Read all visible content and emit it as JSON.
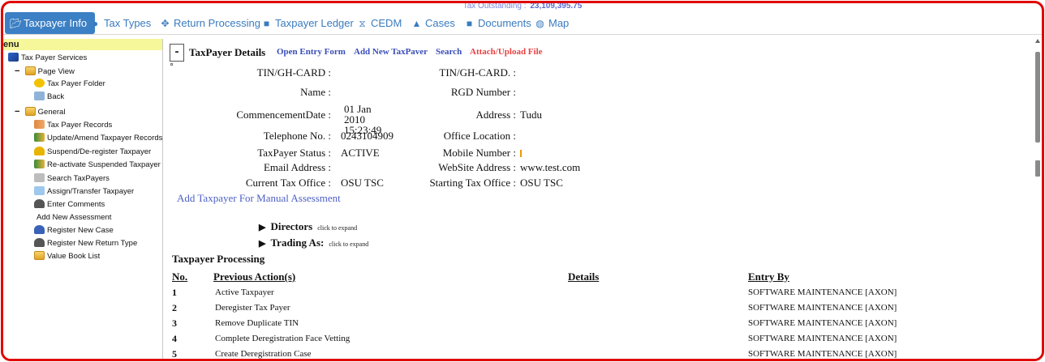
{
  "header": {
    "outstanding_label": "Tax Outstanding :",
    "outstanding_value": "23,109,395.75"
  },
  "nav": [
    {
      "label": "Taxpayer Info",
      "icon": "folder-open-icon"
    },
    {
      "label": "Tax Types",
      "icon": "drop-icon"
    },
    {
      "label": "Return Processing",
      "icon": "move-icon"
    },
    {
      "label": "Taxpayer Ledger",
      "icon": "file-icon"
    },
    {
      "label": "CEDM",
      "icon": "hourglass-icon"
    },
    {
      "label": "Cases",
      "icon": "triangle-icon"
    },
    {
      "label": "Documents",
      "icon": "document-icon"
    },
    {
      "label": "Map",
      "icon": "globe-icon"
    }
  ],
  "sidebar": {
    "header": "enu",
    "root": "Tax Payer Services",
    "groups": [
      {
        "label": "Page View",
        "toggle": "−",
        "items": [
          "Tax Payer Folder",
          "Back"
        ]
      },
      {
        "label": "General",
        "toggle": "−",
        "items": [
          "Tax Payer Records",
          "Update/Amend Taxpayer Records",
          "Suspend/De-register Taxpayer",
          "Re-activate Suspended Taxpayer",
          "Search TaxPayers",
          "Assign/Transfer Taxpayer",
          "Enter Comments",
          "Add New Assessment",
          "Register New Case",
          "Register New Return Type",
          "Value Book List"
        ]
      }
    ]
  },
  "main": {
    "toggle": "-",
    "title": "TaxPayer Details",
    "links": [
      "Open Entry Form",
      "Add New TaxPaver",
      "Search",
      "Attach/Upload File"
    ],
    "fields_left": [
      {
        "label": "TIN/GH-CARD :",
        "value": ""
      },
      {
        "label": "Name :",
        "value": ""
      },
      {
        "label": "CommencementDate :",
        "value": "01 Jan 2010 15:23:49"
      },
      {
        "label": "Telephone No. :",
        "value": "0243104909"
      },
      {
        "label": "TaxPayer Status :",
        "value": "ACTIVE"
      },
      {
        "label": "Email Address :",
        "value": ""
      },
      {
        "label": "Current Tax Office :",
        "value": "OSU TSC"
      }
    ],
    "fields_right": [
      {
        "label": "TIN/GH-CARD. :",
        "value": ""
      },
      {
        "label": "RGD Number :",
        "value": ""
      },
      {
        "label": "Address :",
        "value": "Tudu"
      },
      {
        "label": "Office Location :",
        "value": ""
      },
      {
        "label": "Mobile Number :",
        "value": ""
      },
      {
        "label": "WebSite Address :",
        "value": "www.test.com"
      },
      {
        "label": "Starting Tax Office :",
        "value": "OSU TSC"
      }
    ],
    "manual_link": "Add Taxpayer For Manual Assessment",
    "expanders": [
      {
        "label": "Directors",
        "hint": "click to expand"
      },
      {
        "label": "Trading As:",
        "hint": "click to expand"
      }
    ],
    "processing": {
      "title": "Taxpayer Processing",
      "columns": [
        "No.",
        "Previous Action(s)",
        "Details",
        "Entry By"
      ],
      "rows": [
        {
          "no": "1",
          "action": "Active Taxpayer",
          "details": "",
          "entry_by": "SOFTWARE MAINTENANCE [AXON]"
        },
        {
          "no": "2",
          "action": "Deregister Tax Payer",
          "details": "",
          "entry_by": "SOFTWARE MAINTENANCE [AXON]"
        },
        {
          "no": "3",
          "action": "Remove Duplicate TIN",
          "details": "",
          "entry_by": "SOFTWARE MAINTENANCE [AXON]"
        },
        {
          "no": "4",
          "action": "Complete Deregistration Face Vetting",
          "details": "",
          "entry_by": "SOFTWARE MAINTENANCE [AXON]"
        },
        {
          "no": "5",
          "action": "Create Deregistration Case",
          "details": "",
          "entry_by": "SOFTWARE MAINTENANCE [AXON]"
        }
      ]
    }
  },
  "colors": {
    "frame": "#e00000",
    "nav_active": "#3b7fc4",
    "nav_text": "#3a7bbf",
    "link": "#3a4eb8",
    "link_red": "#e84040",
    "sidebar_header": "#f6f69a"
  }
}
